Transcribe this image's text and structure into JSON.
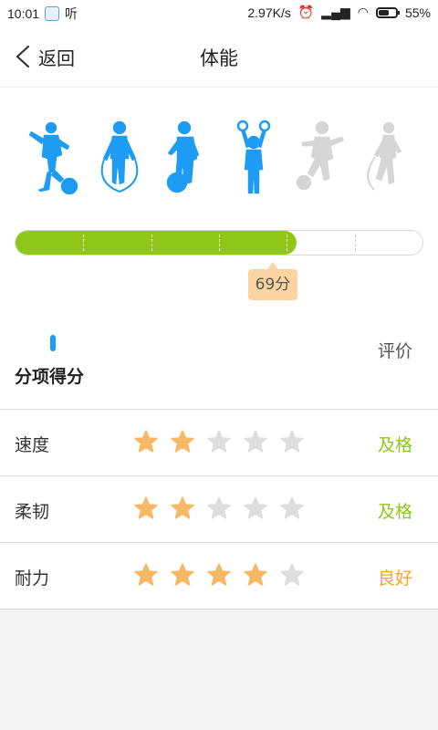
{
  "status_bar": {
    "time": "10:01",
    "app_label": "听",
    "network_speed": "2.97K/s",
    "battery": "55%"
  },
  "header": {
    "back_label": "返回",
    "title": "体能"
  },
  "figures": [
    {
      "name": "kicking-ball-child",
      "active": true
    },
    {
      "name": "jump-rope-child",
      "active": true
    },
    {
      "name": "bouncing-ball-child",
      "active": true
    },
    {
      "name": "rings-child",
      "active": true
    },
    {
      "name": "soccer-child",
      "active": false
    },
    {
      "name": "skipping-child",
      "active": false
    }
  ],
  "progress": {
    "score": 69,
    "score_label": "69分",
    "max": 100
  },
  "section": {
    "label": "分项得分",
    "eval_label": "评价"
  },
  "items": [
    {
      "label": "速度",
      "stars": 2,
      "max_stars": 5,
      "grade": "及格",
      "grade_color": "#8fc718"
    },
    {
      "label": "柔韧",
      "stars": 2,
      "max_stars": 5,
      "grade": "及格",
      "grade_color": "#8fc718"
    },
    {
      "label": "耐力",
      "stars": 4,
      "max_stars": 5,
      "grade": "良好",
      "grade_color": "#f5a623"
    }
  ],
  "colors": {
    "accent_blue": "#1e9cf3",
    "inactive_gray": "#d6d6d6",
    "progress_green": "#8fc718",
    "star_filled": "#f7b967",
    "star_empty": "#dedede"
  }
}
